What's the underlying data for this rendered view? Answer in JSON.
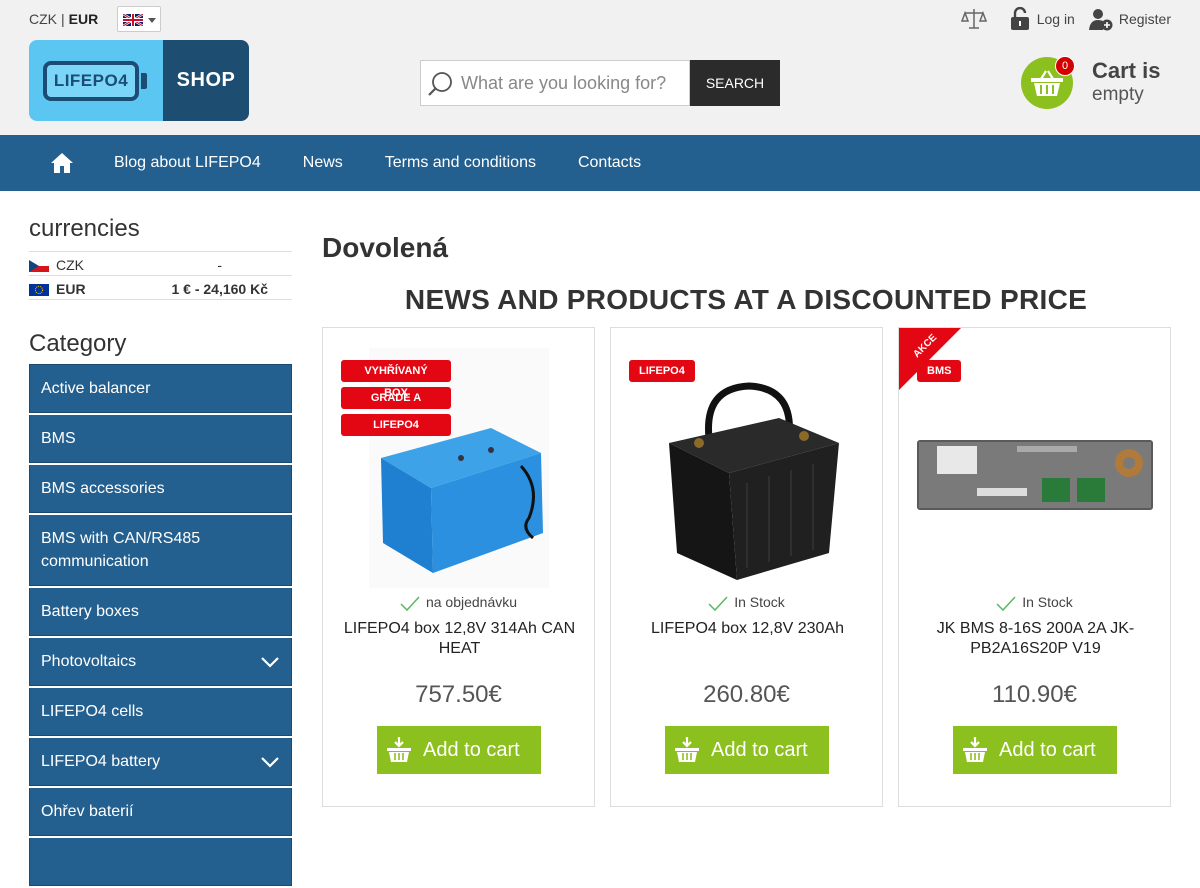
{
  "header": {
    "currency_czk": "CZK",
    "currency_sep": "|",
    "currency_eur": "EUR",
    "login_label": "Log in",
    "register_label": "Register",
    "logo_text_left": "LIFEPO4",
    "logo_text_right": "SHOP",
    "search_placeholder": "What are you looking for?",
    "search_button": "SEARCH",
    "cart_count": "0",
    "cart_title": "Cart is",
    "cart_status": "empty"
  },
  "nav": {
    "items": [
      "Blog about LIFEPO4",
      "News",
      "Terms and conditions",
      "Contacts"
    ]
  },
  "sidebar": {
    "currencies_title": "currencies",
    "currencies": [
      {
        "code": "CZK",
        "rate": "-"
      },
      {
        "code": "EUR",
        "rate": "1 € - 24,160 Kč"
      }
    ],
    "category_title": "Category",
    "categories": [
      "Active balancer",
      "BMS",
      "BMS accessories",
      "BMS with CAN/RS485 communication",
      "Battery boxes",
      "Photovoltaics",
      "LIFEPO4 cells",
      "LIFEPO4 battery",
      "Ohřev baterií"
    ]
  },
  "main": {
    "page_title": "Dovolená",
    "section_title": "NEWS AND PRODUCTS AT A DISCOUNTED PRICE",
    "products": [
      {
        "flags": [
          "VYHŘÍVANÝ BOX",
          "GRADE A",
          "LIFEPO4"
        ],
        "availability": "na objednávku",
        "name": "LIFEPO4 box 12,8V 314Ah CAN HEAT",
        "price": "757.50",
        "currency": "€",
        "add_to_cart": "Add to cart"
      },
      {
        "flags": [
          "LIFEPO4"
        ],
        "availability": "In Stock",
        "name": "LIFEPO4 box 12,8V 230Ah",
        "price": "260.80",
        "currency": "€",
        "add_to_cart": "Add to cart"
      },
      {
        "flags": [
          "BMS"
        ],
        "corner_label": "AKCE",
        "availability": "In Stock",
        "name": "JK BMS 8-16S 200A 2A JK-PB2A16S20P V19",
        "price": "110.90",
        "currency": "€",
        "add_to_cart": "Add to cart"
      }
    ]
  },
  "colors": {
    "nav_blue": "#24608f",
    "accent_green": "#8cc01e",
    "badge_red": "#e30613"
  }
}
